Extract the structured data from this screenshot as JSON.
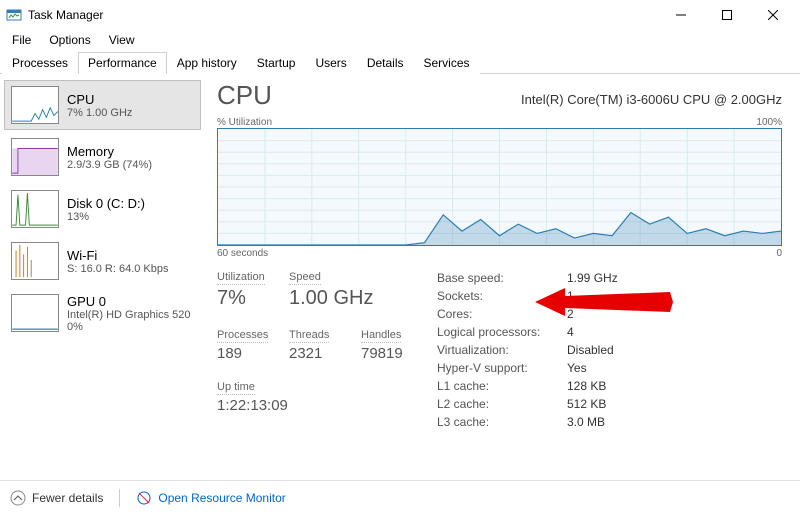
{
  "window": {
    "title": "Task Manager"
  },
  "menubar": [
    "File",
    "Options",
    "View"
  ],
  "tabs": [
    {
      "label": "Processes",
      "active": false
    },
    {
      "label": "Performance",
      "active": true
    },
    {
      "label": "App history",
      "active": false
    },
    {
      "label": "Startup",
      "active": false
    },
    {
      "label": "Users",
      "active": false
    },
    {
      "label": "Details",
      "active": false
    },
    {
      "label": "Services",
      "active": false
    }
  ],
  "sidebar": [
    {
      "name": "cpu",
      "title": "CPU",
      "sub": "7%  1.00 GHz",
      "active": true,
      "color": "#2b7db0"
    },
    {
      "name": "mem",
      "title": "Memory",
      "sub": "2.9/3.9 GB (74%)",
      "active": false,
      "color": "#8b3db0"
    },
    {
      "name": "disk",
      "title": "Disk 0 (C: D:)",
      "sub": "13%",
      "active": false,
      "color": "#3a8a3a"
    },
    {
      "name": "wifi",
      "title": "Wi-Fi",
      "sub": "S: 16.0  R: 64.0 Kbps",
      "active": false,
      "color": "#c47a1a"
    },
    {
      "name": "gpu",
      "title": "GPU 0",
      "sub": "Intel(R) HD Graphics 520\n0%",
      "active": false,
      "color": "#1a5a8a"
    }
  ],
  "main": {
    "heading": "CPU",
    "cpu_model": "Intel(R) Core(TM) i3-6006U CPU @ 2.00GHz",
    "graph_top_left": "% Utilization",
    "graph_top_right": "100%",
    "graph_bottom_left": "60 seconds",
    "graph_bottom_right": "0"
  },
  "stats_left": {
    "utilization_label": "Utilization",
    "utilization_value": "7%",
    "speed_label": "Speed",
    "speed_value": "1.00 GHz",
    "processes_label": "Processes",
    "processes_value": "189",
    "threads_label": "Threads",
    "threads_value": "2321",
    "handles_label": "Handles",
    "handles_value": "79819",
    "uptime_label": "Up time",
    "uptime_value": "1:22:13:09"
  },
  "stats_right": [
    {
      "k": "Base speed:",
      "v": "1.99 GHz"
    },
    {
      "k": "Sockets:",
      "v": "1"
    },
    {
      "k": "Cores:",
      "v": "2"
    },
    {
      "k": "Logical processors:",
      "v": "4"
    },
    {
      "k": "Virtualization:",
      "v": "Disabled"
    },
    {
      "k": "Hyper-V support:",
      "v": "Yes"
    },
    {
      "k": "L1 cache:",
      "v": "128 KB"
    },
    {
      "k": "L2 cache:",
      "v": "512 KB"
    },
    {
      "k": "L3 cache:",
      "v": "3.0 MB"
    }
  ],
  "footer": {
    "fewer_details": "Fewer details",
    "open_monitor": "Open Resource Monitor"
  },
  "chart_data": {
    "type": "line",
    "title": "CPU % Utilization",
    "xlabel": "seconds ago",
    "ylabel": "% Utilization",
    "xlim": [
      60,
      0
    ],
    "ylim": [
      0,
      100
    ],
    "x": [
      60,
      55,
      50,
      45,
      40,
      38,
      36,
      34,
      32,
      30,
      28,
      26,
      24,
      22,
      20,
      18,
      16,
      14,
      12,
      10,
      8,
      6,
      4,
      2,
      0
    ],
    "values": [
      0,
      0,
      0,
      0,
      0,
      2,
      26,
      12,
      22,
      8,
      18,
      10,
      14,
      6,
      10,
      8,
      28,
      18,
      24,
      10,
      14,
      8,
      12,
      10,
      12
    ]
  }
}
